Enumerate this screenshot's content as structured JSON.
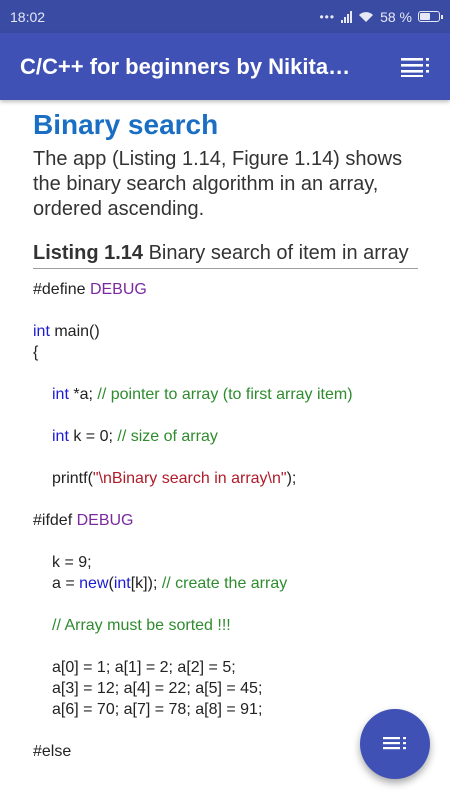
{
  "status_bar": {
    "time": "18:02",
    "battery": "58 %",
    "battery_level": 0.58
  },
  "app_bar": {
    "title": "C/C++ for beginners by Nikita…",
    "menu_icon": "list-menu-icon"
  },
  "article": {
    "heading": "Binary search",
    "intro": "The app (Listing 1.14, Figure 1.14) shows the binary search algorithm in an array, ordered ascending.",
    "listing_label": "Listing 1.14",
    "listing_caption": " Binary search of item in array"
  },
  "code": {
    "l1_a": "#define ",
    "l1_b": "DEBUG",
    "l2_a": "int",
    "l2_b": " main()",
    "l3": "{",
    "l4_a": "int",
    "l4_b": " *a; ",
    "l4_c": "// pointer to array (to first array item)",
    "l5_a": "int",
    "l5_b": " k = 0; ",
    "l5_c": "// size of array",
    "l6_a": "printf(",
    "l6_b": "\"\\nBinary search in array\\n\"",
    "l6_c": ");",
    "l7_a": "#ifdef ",
    "l7_b": "DEBUG",
    "l8": "k = 9;",
    "l9_a": "a = ",
    "l9_b": "new",
    "l9_c": "(",
    "l9_d": "int",
    "l9_e": "[k]); ",
    "l9_f": "// create the array",
    "l10": "// Array must be sorted !!!",
    "l11": "a[0] = 1; a[1] = 2; a[2] = 5;",
    "l12": "a[3] = 12; a[4] = 22; a[5] = 45;",
    "l13": "a[6] = 70; a[7] = 78; a[8] = 91;",
    "l14": "#else"
  },
  "fab": {
    "icon": "toc-list-icon"
  }
}
